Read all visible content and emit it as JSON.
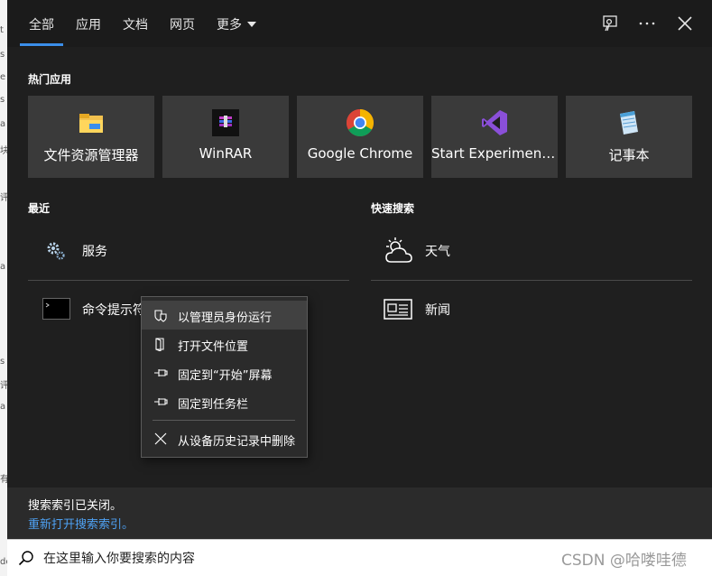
{
  "background_fragments": [
    "t",
    "s",
    "e",
    "s",
    "a",
    "块",
    "评",
    "a",
    "s",
    "评",
    "a",
    "有",
    "dc"
  ],
  "nav": {
    "tabs": [
      {
        "label": "全部"
      },
      {
        "label": "应用"
      },
      {
        "label": "文档"
      },
      {
        "label": "网页"
      },
      {
        "label": "更多"
      }
    ],
    "icons": [
      "feedback-icon",
      "more-options-icon",
      "close-icon"
    ]
  },
  "top_apps": {
    "heading": "热门应用",
    "items": [
      {
        "label": "文件资源管理器",
        "icon": "file-explorer-icon"
      },
      {
        "label": "WinRAR",
        "icon": "winrar-icon"
      },
      {
        "label": "Google Chrome",
        "icon": "chrome-icon"
      },
      {
        "label": "Start Experiment...",
        "icon": "visual-studio-icon"
      },
      {
        "label": "记事本",
        "icon": "notepad-icon"
      }
    ]
  },
  "recent": {
    "heading": "最近",
    "items": [
      {
        "label": "服务",
        "icon": "services-gear-icon"
      },
      {
        "label": "命令提示符",
        "icon": "cmd-icon"
      }
    ]
  },
  "quick_search": {
    "heading": "快速搜索",
    "items": [
      {
        "label": "天气",
        "icon": "weather-icon"
      },
      {
        "label": "新闻",
        "icon": "news-icon"
      }
    ]
  },
  "context_menu": {
    "items": [
      {
        "label": "以管理员身份运行",
        "icon": "shield-icon"
      },
      {
        "label": "打开文件位置",
        "icon": "folder-open-icon"
      },
      {
        "label": "固定到“开始”屏幕",
        "icon": "pin-icon"
      },
      {
        "label": "固定到任务栏",
        "icon": "pin-icon"
      },
      {
        "label": "从设备历史记录中删除",
        "icon": "close-icon"
      }
    ]
  },
  "footer": {
    "message": "搜索索引已关闭。",
    "link": "重新打开搜索索引。"
  },
  "search": {
    "placeholder": "在这里输入你要搜索的内容",
    "value": ""
  },
  "watermark": "CSDN @哈喽哇德",
  "colors": {
    "accent": "#3b8eea",
    "panel_bg": "#1f1f1f",
    "tile_bg": "#3a3a3a",
    "link": "#4ea1f3"
  }
}
